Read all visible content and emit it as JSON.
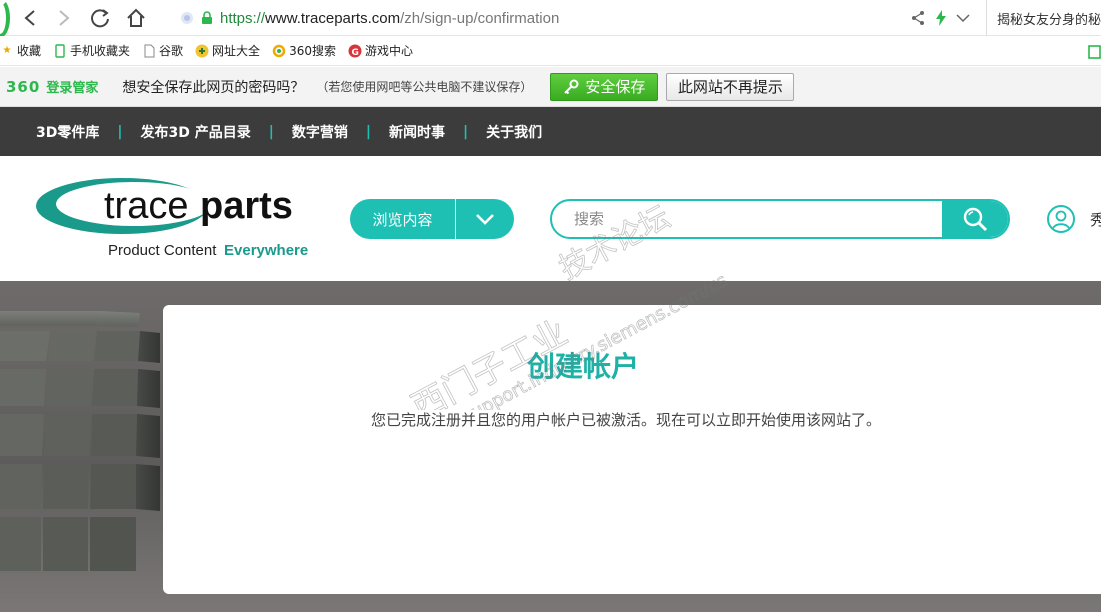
{
  "browser": {
    "url_scheme": "https://",
    "url_domain": "www.traceparts.com",
    "url_path": "/zh/sign-up/confirmation",
    "news_tab": "揭秘女友分身的秘"
  },
  "bookmarks": [
    {
      "label": "收藏",
      "icon": "star-icon"
    },
    {
      "label": "手机收藏夹",
      "icon": "phone-icon"
    },
    {
      "label": "谷歌",
      "icon": "page-icon"
    },
    {
      "label": "网址大全",
      "icon": "globe-icon"
    },
    {
      "label": "360搜索",
      "icon": "search-360-icon"
    },
    {
      "label": "游戏中心",
      "icon": "game-icon"
    }
  ],
  "password_bar": {
    "brand": "360",
    "brand_sub": "登录管家",
    "question": "想安全保存此网页的密码吗？",
    "note": "（若您使用网吧等公共电脑不建议保存）",
    "save_label": "安全保存",
    "never_label": "此网站不再提示"
  },
  "site_nav": {
    "items": [
      "3D零件库",
      "发布3D 产品目录",
      "数字营销",
      "新闻时事",
      "关于我们"
    ]
  },
  "header": {
    "logo_text_light": "trace",
    "logo_text_bold": "parts",
    "logo_tagline_1": "Product Content ",
    "logo_tagline_2": "Everywhere",
    "browse_label": "浏览内容",
    "search_placeholder": "搜索",
    "user_label": "秀"
  },
  "content": {
    "title": "创建帐户",
    "message": "您已完成注册并且您的用户帐户已被激活。现在可以立即开始使用该网站了。"
  },
  "watermark": {
    "line1": "西门子工业",
    "line2": "support.industry.siemens.com/cs",
    "line3": "技术论坛"
  },
  "colors": {
    "accent": "#1fc0b4",
    "title": "#1fb0a6",
    "nav_bg": "#3c3c3c",
    "green": "#2db84d"
  }
}
